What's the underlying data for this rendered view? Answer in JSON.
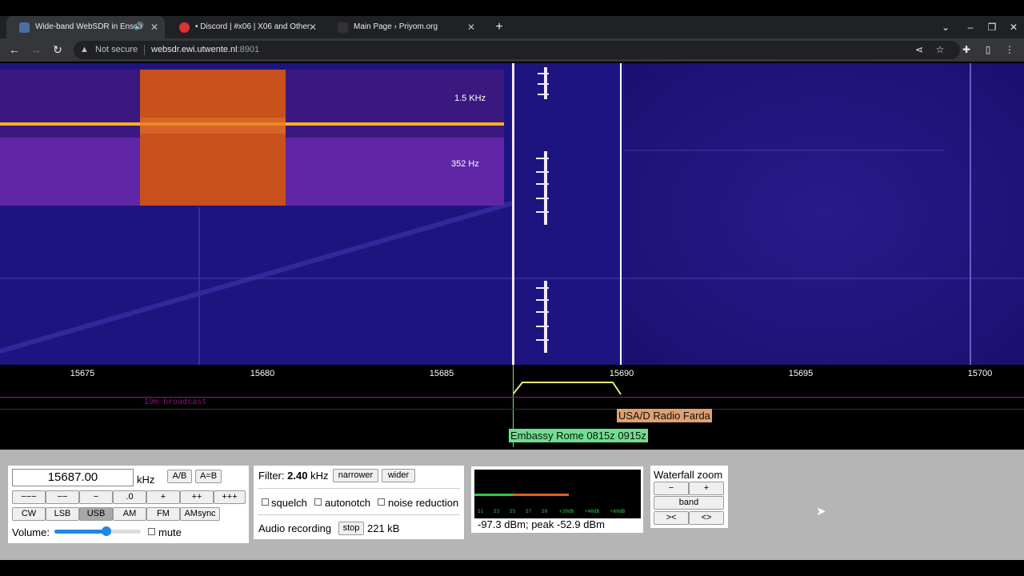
{
  "browser": {
    "tabs": [
      {
        "title": "Wide-band WebSDR in Ensch",
        "active": true
      },
      {
        "title": "• Discord | #x06 | X06 and Other",
        "active": false
      },
      {
        "title": "Main Page › Priyom.org",
        "active": false
      }
    ],
    "new_tab_label": "+",
    "address": {
      "security_label": "Not secure",
      "host": "websdr.ewi.utwente.nl",
      "port": ":8901"
    }
  },
  "waterfall": {
    "zoom_labels": [
      "1.5  KHz",
      "352  Hz"
    ],
    "frequency_ticks": [
      "15675",
      "15680",
      "15685",
      "15690",
      "15695",
      "15700"
    ],
    "band_label": "19m broadcast",
    "stations": [
      "USA/D Radio Farda",
      "Embassy Rome 0815z 0915z"
    ],
    "colors": {
      "station_farda": "#e0a070",
      "station_rome": "#6fe08f",
      "band": "#a0108a"
    }
  },
  "controls": {
    "frequency": "15687.00",
    "unit": "kHz",
    "ab_buttons": [
      "A/B",
      "A=B"
    ],
    "step_buttons": [
      "−−−",
      "−−",
      "−",
      ".0",
      "+",
      "++",
      "+++"
    ],
    "modes": [
      "CW",
      "LSB",
      "USB",
      "AM",
      "FM",
      "AMsync"
    ],
    "selected_mode": "USB",
    "volume_label": "Volume:",
    "volume_level": 0.6,
    "mute_label": "mute"
  },
  "filter": {
    "label": "Filter:",
    "value": "2.40",
    "unit": "kHz",
    "narrower": "narrower",
    "wider": "wider",
    "options": [
      "squelch",
      "autonotch",
      "noise reduction"
    ],
    "recording_label": "Audio recording",
    "stop": "stop",
    "size": "221 kB"
  },
  "smeter": {
    "scale": [
      "S1",
      "S3",
      "S5",
      "S7",
      "S9",
      "+20dB",
      "+40dB",
      "+60dB"
    ],
    "reading": "-97.3 dBm; peak  -52.9 dBm"
  },
  "zoom": {
    "title": "Waterfall zoom",
    "minus": "−",
    "plus": "+",
    "band": "band",
    "narrow": "><",
    "wide": "<>"
  }
}
